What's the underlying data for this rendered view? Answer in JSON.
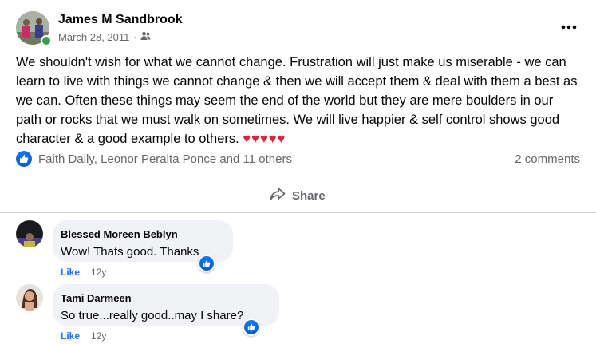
{
  "post": {
    "author": "James M Sandbrook",
    "date": "March 28, 2011",
    "separator": "·",
    "audience_icon": "friends-icon",
    "more_icon": "more-options-icon",
    "body": "We shouldn't wish for what we cannot change. Frustration will just make us miserable - we can learn to live with things we cannot change & then we will accept them & deal with them a best as we can. Often these things may seem the end of the world but they are mere boulders in our path or rocks that we must walk on sometimes. We will live happier & self control shows good character & a good example to others.",
    "hearts": "♥♥♥♥♥"
  },
  "reactions": {
    "icon": "like-icon",
    "names": "Faith Daily, Leonor Peralta Ponce and 11 others",
    "comment_count": "2 comments"
  },
  "actions": {
    "share_label": "Share",
    "share_icon": "share-icon"
  },
  "comments": [
    {
      "name": "Blessed Moreen Beblyn",
      "text": "Wow! Thats good. Thanks",
      "like_label": "Like",
      "age": "12y",
      "reaction_icon": "like-icon"
    },
    {
      "name": "Tami Darmeen",
      "text": "So true...really good..may I share?",
      "like_label": "Like",
      "age": "12y",
      "reaction_icon": "like-icon"
    }
  ],
  "colors": {
    "accent": "#1877f2",
    "secondary_text": "#65676b",
    "bubble": "#f0f2f5",
    "heart": "#e41e3f",
    "online": "#31a24c"
  }
}
